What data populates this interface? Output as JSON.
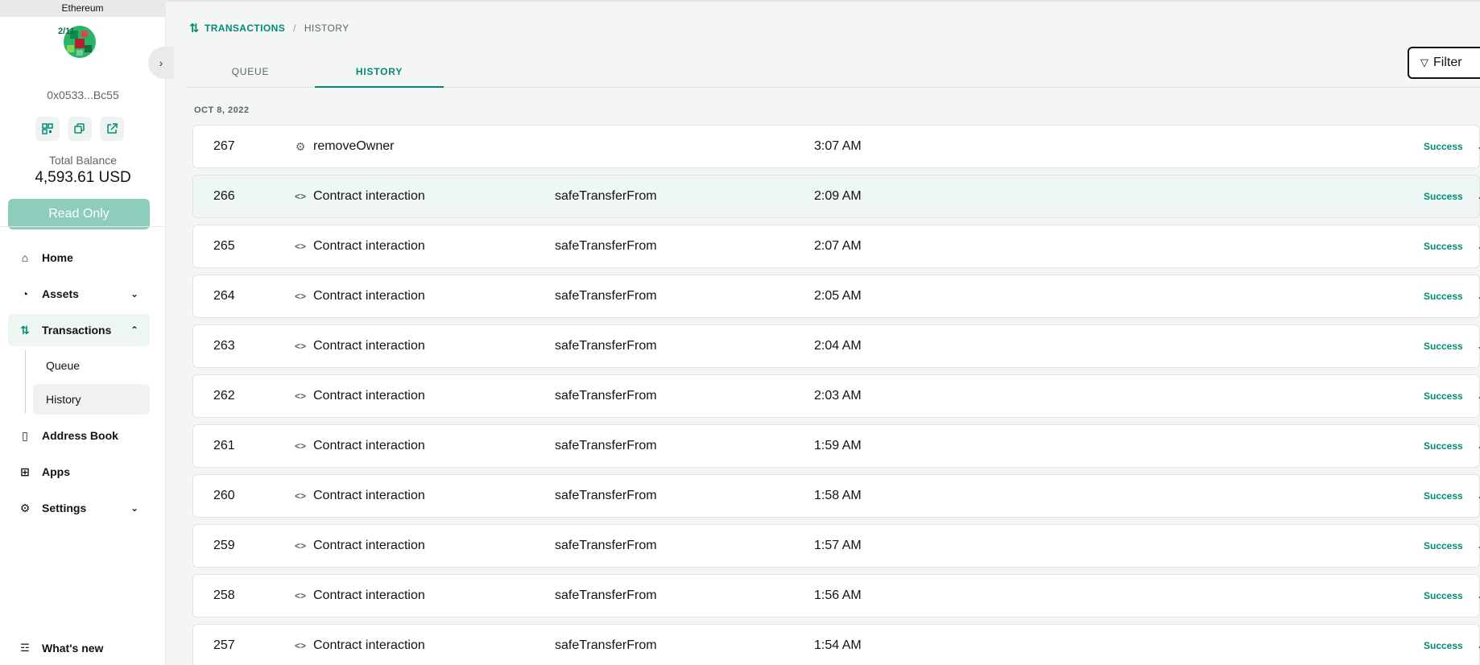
{
  "network": "Ethereum",
  "safe": {
    "threshold": "2/11",
    "address": "0x0533...Bc55",
    "balance_label": "Total Balance",
    "balance_value": "4,593.61 USD",
    "read_only_label": "Read Only"
  },
  "nav": {
    "home": "Home",
    "assets": "Assets",
    "transactions": "Transactions",
    "queue": "Queue",
    "history": "History",
    "address_book": "Address Book",
    "apps": "Apps",
    "settings": "Settings",
    "whats_new": "What's new"
  },
  "breadcrumb": {
    "section": "TRANSACTIONS",
    "current": "HISTORY"
  },
  "tabs": {
    "queue": "QUEUE",
    "history": "HISTORY"
  },
  "filter_label": "Filter",
  "date_group": "OCT 8, 2022",
  "colors": {
    "accent": "#008c73",
    "status_success": "#008c73",
    "read_only_button": "#8ecdbb"
  },
  "transactions": [
    {
      "nonce": "267",
      "icon": "gear-icon",
      "type": "removeOwner",
      "method": "",
      "time": "3:07 AM",
      "status": "Success"
    },
    {
      "nonce": "266",
      "icon": "code-icon",
      "type": "Contract interaction",
      "method": "safeTransferFrom",
      "time": "2:09 AM",
      "status": "Success"
    },
    {
      "nonce": "265",
      "icon": "code-icon",
      "type": "Contract interaction",
      "method": "safeTransferFrom",
      "time": "2:07 AM",
      "status": "Success"
    },
    {
      "nonce": "264",
      "icon": "code-icon",
      "type": "Contract interaction",
      "method": "safeTransferFrom",
      "time": "2:05 AM",
      "status": "Success"
    },
    {
      "nonce": "263",
      "icon": "code-icon",
      "type": "Contract interaction",
      "method": "safeTransferFrom",
      "time": "2:04 AM",
      "status": "Success"
    },
    {
      "nonce": "262",
      "icon": "code-icon",
      "type": "Contract interaction",
      "method": "safeTransferFrom",
      "time": "2:03 AM",
      "status": "Success"
    },
    {
      "nonce": "261",
      "icon": "code-icon",
      "type": "Contract interaction",
      "method": "safeTransferFrom",
      "time": "1:59 AM",
      "status": "Success"
    },
    {
      "nonce": "260",
      "icon": "code-icon",
      "type": "Contract interaction",
      "method": "safeTransferFrom",
      "time": "1:58 AM",
      "status": "Success"
    },
    {
      "nonce": "259",
      "icon": "code-icon",
      "type": "Contract interaction",
      "method": "safeTransferFrom",
      "time": "1:57 AM",
      "status": "Success"
    },
    {
      "nonce": "258",
      "icon": "code-icon",
      "type": "Contract interaction",
      "method": "safeTransferFrom",
      "time": "1:56 AM",
      "status": "Success"
    },
    {
      "nonce": "257",
      "icon": "code-icon",
      "type": "Contract interaction",
      "method": "safeTransferFrom",
      "time": "1:54 AM",
      "status": "Success"
    }
  ]
}
